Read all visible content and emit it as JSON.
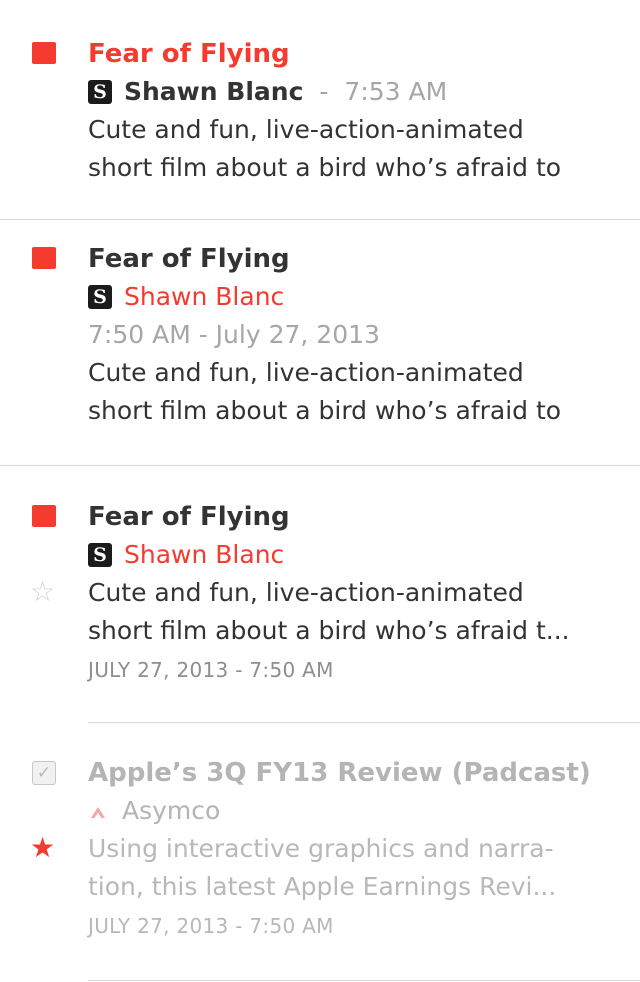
{
  "articles": [
    {
      "title": "Fear of Flying",
      "source": "Shawn Blanc",
      "source_badge": "S",
      "separator": "-",
      "time": "7:53 AM",
      "snippet": [
        "Cute and fun, live-action-animated",
        "short film about a bird who’s afraid to"
      ]
    },
    {
      "title": "Fear of Flying",
      "source": "Shawn Blanc",
      "source_badge": "S",
      "datetime": "7:50 AM - July 27, 2013",
      "snippet": [
        "Cute and fun, live-action-animated",
        "short film about a bird who’s afraid to"
      ]
    },
    {
      "title": "Fear of Flying",
      "source": "Shawn Blanc",
      "source_badge": "S",
      "snippet": [
        "Cute and fun, live-action-animated",
        "short film about a bird who’s afraid t..."
      ],
      "date": "JULY 27, 2013 - 7:50 AM"
    },
    {
      "title": "Apple’s 3Q FY13 Review (Padcast)",
      "source": "Asymco",
      "snippet": [
        "Using interactive graphics and narra-",
        "tion, this latest Apple Earnings Revi..."
      ],
      "date": "JULY 27, 2013 - 7:50 AM"
    }
  ],
  "icons": {
    "unread": "unread-square-icon",
    "star_empty": "☆",
    "star_filled": "★",
    "read_check": "✓"
  },
  "colors": {
    "accent": "#f53b30",
    "text": "#333333",
    "muted": "#a6a6a6",
    "faded": "#b8b8b8"
  }
}
